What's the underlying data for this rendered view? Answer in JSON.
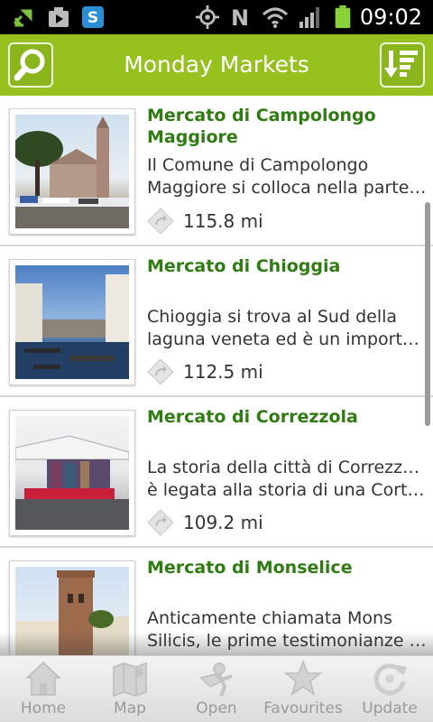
{
  "status_bar": {
    "time": "09:02",
    "icons": [
      "usb-debug-icon",
      "media-play-icon",
      "skype-icon",
      "gps-icon",
      "nfc-icon",
      "wifi-icon",
      "signal-icon",
      "battery-icon"
    ]
  },
  "action_bar": {
    "title": "Monday Markets",
    "left_icon": "search-icon",
    "right_icon": "sort-list-icon",
    "color": "#96c11f"
  },
  "markets": [
    {
      "title": "Mercato di Campolongo Maggiore",
      "desc_line1": "Il Comune di Campolongo",
      "desc_line2": "Maggiore si colloca nella parte ...",
      "distance": "115.8 mi"
    },
    {
      "title": "Mercato di Chioggia",
      "desc_line1": "Chioggia si trova al Sud della",
      "desc_line2": "laguna veneta ed è un importan...",
      "distance": "112.5 mi"
    },
    {
      "title": "Mercato di Correzzola",
      "desc_line1": "La storia della città di Correzzola",
      "desc_line2": "è legata alla storia di una Corte ...",
      "distance": "109.2 mi"
    },
    {
      "title": "Mercato di Monselice",
      "desc_line1": "Anticamente chiamata Mons",
      "desc_line2": "Silicis, le prime testimonianze a...",
      "distance": ""
    }
  ],
  "bottom_nav": [
    {
      "label": "Home",
      "icon": "home-icon"
    },
    {
      "label": "Map",
      "icon": "map-icon"
    },
    {
      "label": "Open",
      "icon": "open-sign-icon"
    },
    {
      "label": "Favourites",
      "icon": "star-icon"
    },
    {
      "label": "Update",
      "icon": "refresh-icon"
    }
  ],
  "title_color": "#2f7d12"
}
